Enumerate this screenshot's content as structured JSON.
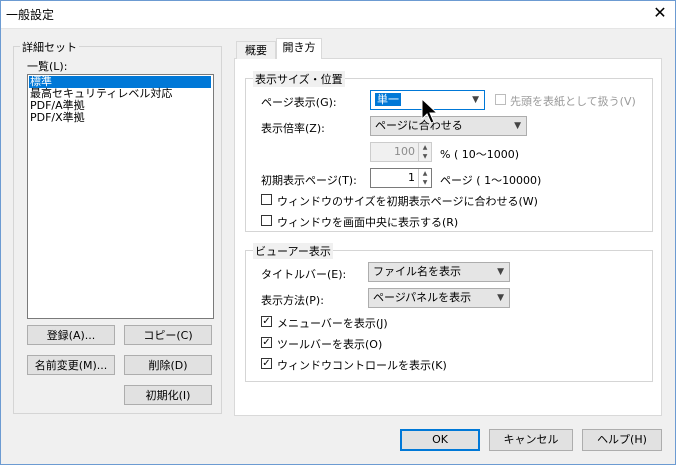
{
  "window": {
    "title": "一般設定"
  },
  "left": {
    "group_label": "詳細セット",
    "list_label": "一覧(L):",
    "items": [
      "標準",
      "最高セキュリティレベル対応",
      "PDF/A準拠",
      "PDF/X準拠"
    ],
    "selected_index": 0,
    "buttons": {
      "register": "登録(A)...",
      "copy": "コピー(C)",
      "rename": "名前変更(M)...",
      "delete": "削除(D)",
      "init": "初期化(I)"
    }
  },
  "tabs": {
    "overview": "概要",
    "open": "開き方",
    "active": "open"
  },
  "display": {
    "group_label": "表示サイズ・位置",
    "page_display_label": "ページ表示(G):",
    "page_display_value": "単一",
    "cover_checkbox_label": "先頭を表紙として扱う(V)",
    "zoom_label": "表示倍率(Z):",
    "zoom_value": "ページに合わせる",
    "zoom_percent_value": "100",
    "zoom_percent_range": "%  (   10～1000)",
    "initial_page_label": "初期表示ページ(T):",
    "initial_page_value": "1",
    "initial_page_range": "ページ  (     1～10000)",
    "fit_window_label": "ウィンドウのサイズを初期表示ページに合わせる(W)",
    "center_window_label": "ウィンドウを画面中央に表示する(R)"
  },
  "viewer": {
    "group_label": "ビューアー表示",
    "titlebar_label": "タイトルバー(E):",
    "titlebar_value": "ファイル名を表示",
    "method_label": "表示方法(P):",
    "method_value": "ページパネルを表示",
    "menubar_label": "メニューバーを表示(J)",
    "toolbar_label": "ツールバーを表示(O)",
    "windowcontrol_label": "ウィンドウコントロールを表示(K)"
  },
  "footer": {
    "ok": "OK",
    "cancel": "キャンセル",
    "help": "ヘルプ(H)"
  },
  "colors": {
    "selection": "#0078d7",
    "window_border": "#6c9bd2"
  }
}
